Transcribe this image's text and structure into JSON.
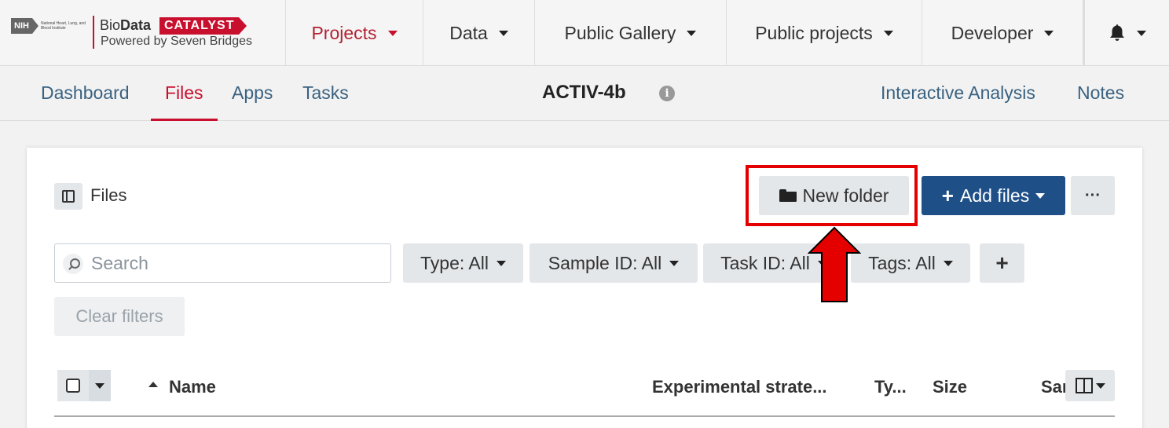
{
  "brand": {
    "nih": "NIH",
    "nih_institute": "National Heart, Lung, and Blood Institute",
    "bio": "Bio",
    "data": "Data",
    "catalyst": "CATALYST",
    "powered_by": "Powered by Seven Bridges",
    "accent": "#c8102e"
  },
  "topnav": {
    "projects": "Projects",
    "data": "Data",
    "public_gallery": "Public Gallery",
    "public_projects": "Public projects",
    "developer": "Developer",
    "notifications_icon": "bell-icon"
  },
  "subnav": {
    "tabs": [
      {
        "label": "Dashboard"
      },
      {
        "label": "Files",
        "active": true
      },
      {
        "label": "Apps"
      },
      {
        "label": "Tasks"
      }
    ],
    "project_title": "ACTIV-4b",
    "interactive_analysis": "Interactive Analysis",
    "notes": "Notes"
  },
  "files_panel": {
    "title": "Files",
    "new_folder": "New folder",
    "add_files": "Add files",
    "more": "···",
    "search_placeholder": "Search",
    "filters": [
      {
        "label": "Type: All"
      },
      {
        "label": "Sample ID: All"
      },
      {
        "label": "Task ID: All"
      },
      {
        "label": "Tags: All"
      }
    ],
    "add_filter": "+",
    "clear_filters": "Clear filters",
    "columns": {
      "name": "Name",
      "experimental_strategy": "Experimental strate...",
      "type": "Ty...",
      "size": "Size",
      "sample": "Samp"
    }
  },
  "colors": {
    "primary_button": "#1e4f87",
    "highlight": "#e50000",
    "link": "#3a6281"
  }
}
